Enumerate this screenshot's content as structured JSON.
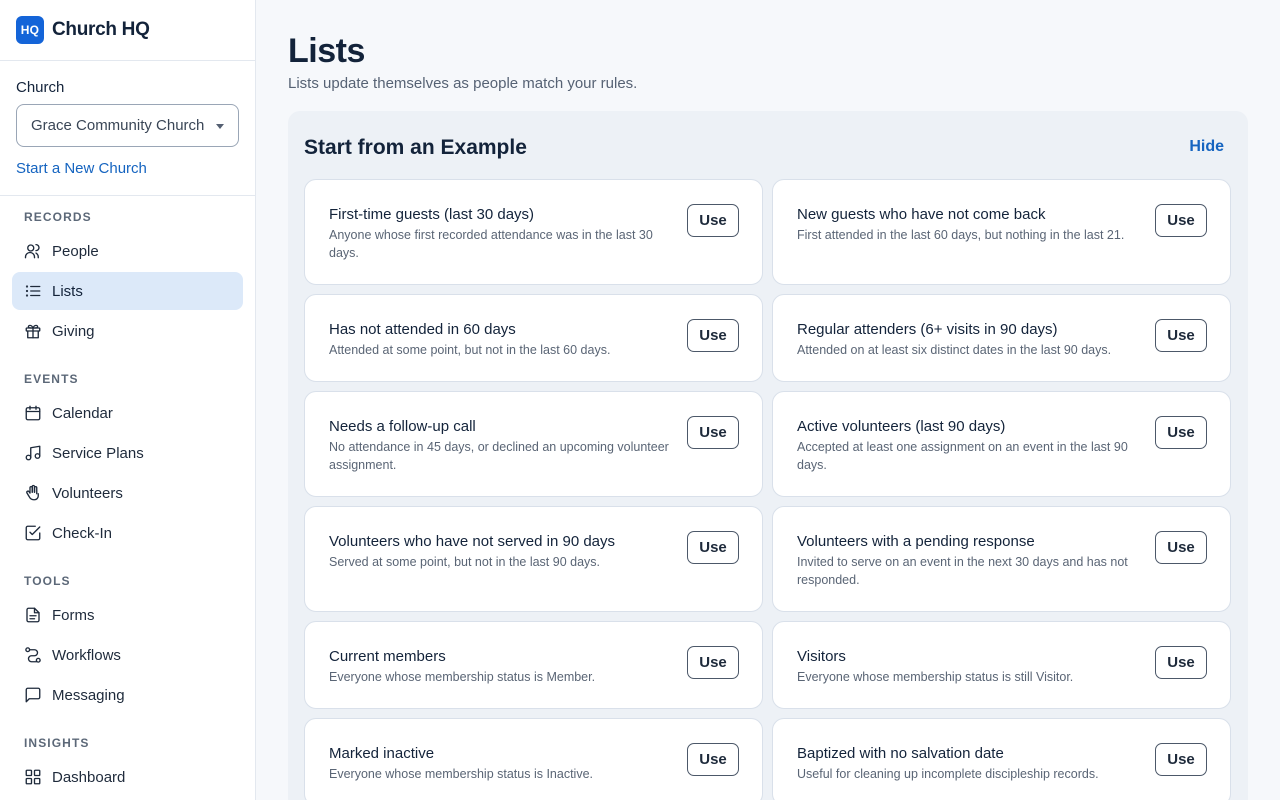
{
  "brand": {
    "logo_text": "HQ",
    "name": "Church HQ"
  },
  "church": {
    "label": "Church",
    "selected": "Grace Community Church (",
    "new_church_link": "Start a New Church"
  },
  "nav": {
    "records_heading": "RECORDS",
    "people": "People",
    "lists": "Lists",
    "giving": "Giving",
    "events_heading": "EVENTS",
    "calendar": "Calendar",
    "service_plans": "Service Plans",
    "volunteers": "Volunteers",
    "check_in": "Check-In",
    "tools_heading": "TOOLS",
    "forms": "Forms",
    "workflows": "Workflows",
    "messaging": "Messaging",
    "insights_heading": "INSIGHTS",
    "dashboard": "Dashboard"
  },
  "page": {
    "title": "Lists",
    "subtitle": "Lists update themselves as people match your rules."
  },
  "examples": {
    "heading": "Start from an Example",
    "hide_label": "Hide",
    "use_label": "Use",
    "items": [
      {
        "title": "First-time guests (last 30 days)",
        "description": "Anyone whose first recorded attendance was in the last 30 days."
      },
      {
        "title": "New guests who have not come back",
        "description": "First attended in the last 60 days, but nothing in the last 21."
      },
      {
        "title": "Has not attended in 60 days",
        "description": "Attended at some point, but not in the last 60 days."
      },
      {
        "title": "Regular attenders (6+ visits in 90 days)",
        "description": "Attended on at least six distinct dates in the last 90 days."
      },
      {
        "title": "Needs a follow-up call",
        "description": "No attendance in 45 days, or declined an upcoming volunteer assignment."
      },
      {
        "title": "Active volunteers (last 90 days)",
        "description": "Accepted at least one assignment on an event in the last 90 days."
      },
      {
        "title": "Volunteers who have not served in 90 days",
        "description": "Served at some point, but not in the last 90 days."
      },
      {
        "title": "Volunteers with a pending response",
        "description": "Invited to serve on an event in the next 30 days and has not responded."
      },
      {
        "title": "Current members",
        "description": "Everyone whose membership status is Member."
      },
      {
        "title": "Visitors",
        "description": "Everyone whose membership status is still Visitor."
      },
      {
        "title": "Marked inactive",
        "description": "Everyone whose membership status is Inactive."
      },
      {
        "title": "Baptized with no salvation date",
        "description": "Useful for cleaning up incomplete discipleship records."
      }
    ]
  }
}
